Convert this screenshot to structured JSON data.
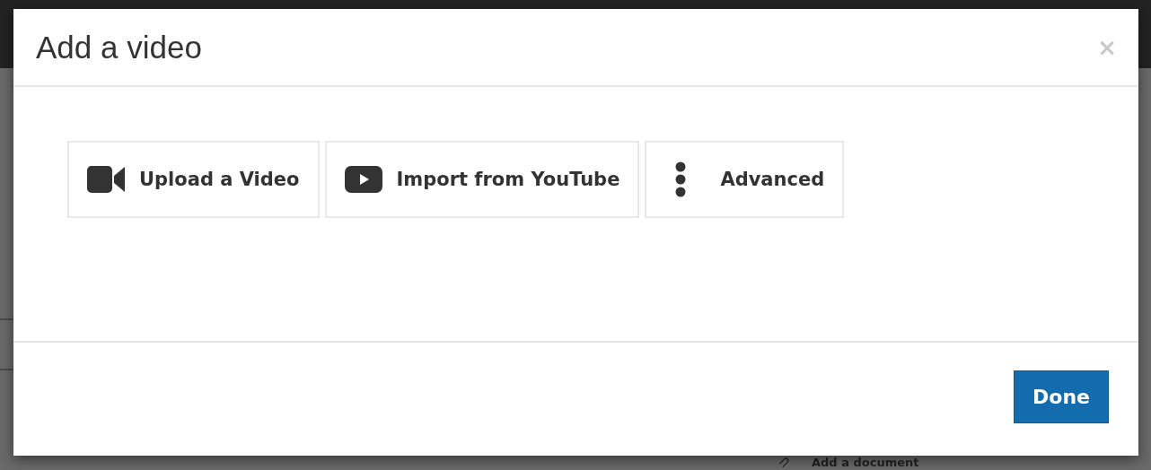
{
  "background": {
    "link": "Add a document"
  },
  "dialog": {
    "title": "Add a video",
    "close": "×",
    "options": [
      {
        "kind": "camera",
        "label": "Upload a Video"
      },
      {
        "kind": "play",
        "label": "Import from YouTube"
      },
      {
        "kind": "dots",
        "label": "Advanced"
      }
    ],
    "done": "Done"
  }
}
